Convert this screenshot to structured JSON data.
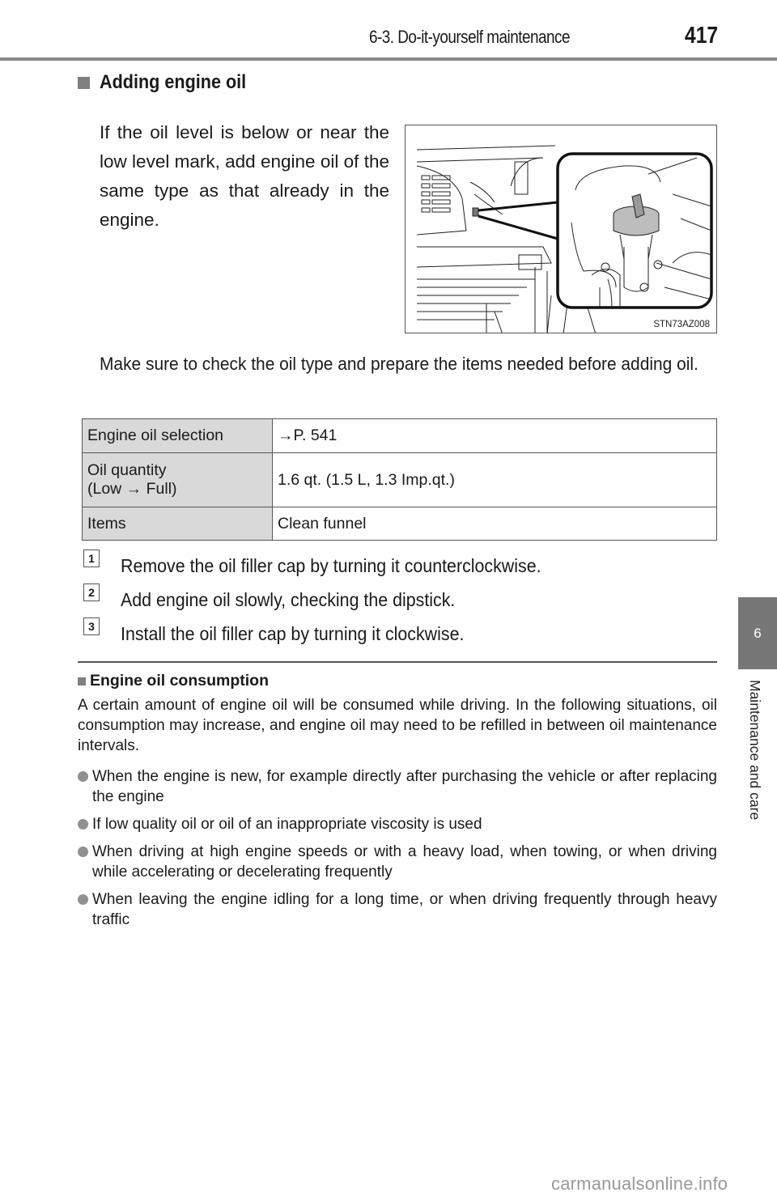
{
  "header": {
    "section": "6-3. Do-it-yourself maintenance",
    "page_number": "417"
  },
  "heading": "Adding engine oil",
  "intro": "If the oil level is below or near the low level mark, add engine oil of the same type as that already in the engine.",
  "figure": {
    "id": "STN73AZ008",
    "icon": "oil-filler-cap-illustration"
  },
  "note": "Make sure to check the oil type and prepare the items needed before adding oil.",
  "spec_table": [
    {
      "label": "Engine oil selection",
      "value": "→P. 541"
    },
    {
      "label": "Oil quantity\n(Low → Full)",
      "label_line1": "Oil quantity",
      "label_line2": "(Low → Full)",
      "value": "1.6 qt. (1.5 L, 1.3 Imp.qt.)"
    },
    {
      "label": "Items",
      "value": "Clean funnel"
    }
  ],
  "steps": [
    {
      "number": "1",
      "text": "Remove the oil filler cap by turning it counterclockwise."
    },
    {
      "number": "2",
      "text": "Add engine oil slowly, checking the dipstick."
    },
    {
      "number": "3",
      "text": "Install the oil filler cap by turning it clockwise."
    }
  ],
  "consumption": {
    "heading": "Engine oil consumption",
    "paragraph": "A certain amount of engine oil will be consumed while driving. In the following situations, oil consumption may increase, and engine oil may need to be refilled in between oil maintenance intervals.",
    "bullets": [
      "When the engine is new, for example directly after purchasing the vehicle or after replacing the engine",
      "If low quality oil or oil of an inappropriate viscosity is used",
      "When driving at high engine speeds or with a heavy load, when towing, or when driving while accelerating or decelerating frequently",
      "When leaving the engine idling for a long time, or when driving frequently through heavy traffic"
    ]
  },
  "side_tab": {
    "chapter_number": "6",
    "chapter_title": "Maintenance and care",
    "color": "#777777"
  },
  "watermark": "carmanualsonline.info"
}
